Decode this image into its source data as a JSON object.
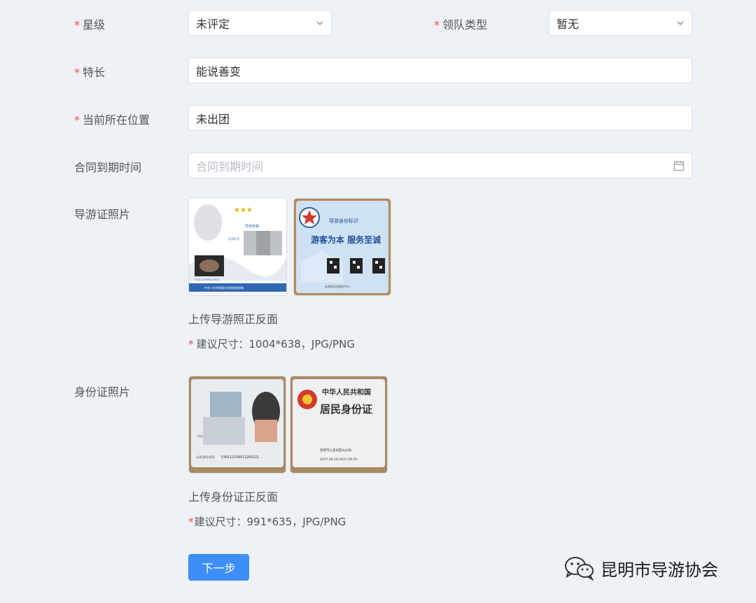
{
  "form": {
    "star": {
      "label": "星级",
      "value": "未评定",
      "required": "*"
    },
    "leader_type": {
      "label": "领队类型",
      "value": "暂无",
      "required": "*"
    },
    "specialty": {
      "label": "特长",
      "value": "能说善变",
      "required": "*"
    },
    "location": {
      "label": "当前所在位置",
      "value": "未出团",
      "required": "*"
    },
    "contract": {
      "label": "合同到期时间",
      "placeholder": "合同到期时间"
    },
    "guide_photo": {
      "label": "导游证照片",
      "upload_hint": "上传导游照正反面",
      "size_hint": "建议尺寸：1004*638，JPG/PNG",
      "required": "*",
      "front_card": {
        "stars": "★★★",
        "line1": "导游资格",
        "line2": "导游证号",
        "id_number": "5301121995122032",
        "footer": "中华人民共和国文化和旅游部制"
      },
      "back_card": {
        "title": "导游身份标识",
        "slogan": "游客为本  服务至诚",
        "footer": "云南省导游服务中心"
      }
    },
    "id_photo": {
      "label": "身份证照片",
      "upload_hint": "上传身份证正反面",
      "size_hint": "建议尺寸：991*635，JPG/PNG",
      "required": "*",
      "front_card": {
        "id_label": "公民身份号码",
        "id_number": "530112199512203221",
        "field": "住址"
      },
      "back_card": {
        "title1": "中华人民共和国",
        "title2": "居民身份证",
        "issuer": "昆明市公安局西山分局",
        "valid": "2017.09.29-2027.09.29"
      }
    },
    "next_button": "下一步"
  },
  "watermark": {
    "text": "昆明市导游协会",
    "icon": "wechat-icon"
  },
  "colors": {
    "accent": "#3d8ff7",
    "required": "#f04b4b",
    "background": "#eef1f6"
  }
}
